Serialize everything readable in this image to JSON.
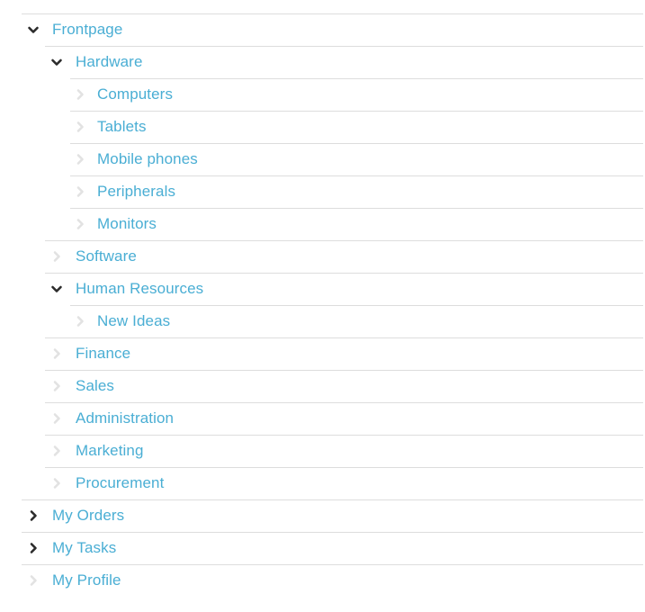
{
  "tree": {
    "name": "navigation-accordion",
    "items": [
      {
        "label": "Frontpage",
        "level": 0,
        "state": "expanded",
        "icon": "chevron-down-icon"
      },
      {
        "label": "Hardware",
        "level": 1,
        "state": "expanded",
        "icon": "chevron-down-icon"
      },
      {
        "label": "Computers",
        "level": 2,
        "state": "leaf",
        "icon": "chevron-right-icon"
      },
      {
        "label": "Tablets",
        "level": 2,
        "state": "leaf",
        "icon": "chevron-right-icon"
      },
      {
        "label": "Mobile phones",
        "level": 2,
        "state": "leaf",
        "icon": "chevron-right-icon"
      },
      {
        "label": "Peripherals",
        "level": 2,
        "state": "leaf",
        "icon": "chevron-right-icon"
      },
      {
        "label": "Monitors",
        "level": 2,
        "state": "leaf",
        "icon": "chevron-right-icon"
      },
      {
        "label": "Software",
        "level": 1,
        "state": "leaf",
        "icon": "chevron-right-icon"
      },
      {
        "label": "Human Resources",
        "level": 1,
        "state": "expanded",
        "icon": "chevron-down-icon"
      },
      {
        "label": "New Ideas",
        "level": 2,
        "state": "leaf",
        "icon": "chevron-right-icon"
      },
      {
        "label": "Finance",
        "level": 1,
        "state": "leaf",
        "icon": "chevron-right-icon"
      },
      {
        "label": "Sales",
        "level": 1,
        "state": "leaf",
        "icon": "chevron-right-icon"
      },
      {
        "label": "Administration",
        "level": 1,
        "state": "leaf",
        "icon": "chevron-right-icon"
      },
      {
        "label": "Marketing",
        "level": 1,
        "state": "leaf",
        "icon": "chevron-right-icon"
      },
      {
        "label": "Procurement",
        "level": 1,
        "state": "leaf",
        "icon": "chevron-right-icon"
      },
      {
        "label": "My Orders",
        "level": 0,
        "state": "collapsed",
        "icon": "chevron-right-icon"
      },
      {
        "label": "My Tasks",
        "level": 0,
        "state": "collapsed",
        "icon": "chevron-right-icon"
      },
      {
        "label": "My Profile",
        "level": 0,
        "state": "leaf",
        "icon": "chevron-right-icon"
      }
    ]
  },
  "colors": {
    "link": "#4aaed4",
    "divider": "#dddddd",
    "chevron_active": "#2b2b2b",
    "chevron_muted": "#e2e2e2",
    "background": "#ffffff"
  }
}
